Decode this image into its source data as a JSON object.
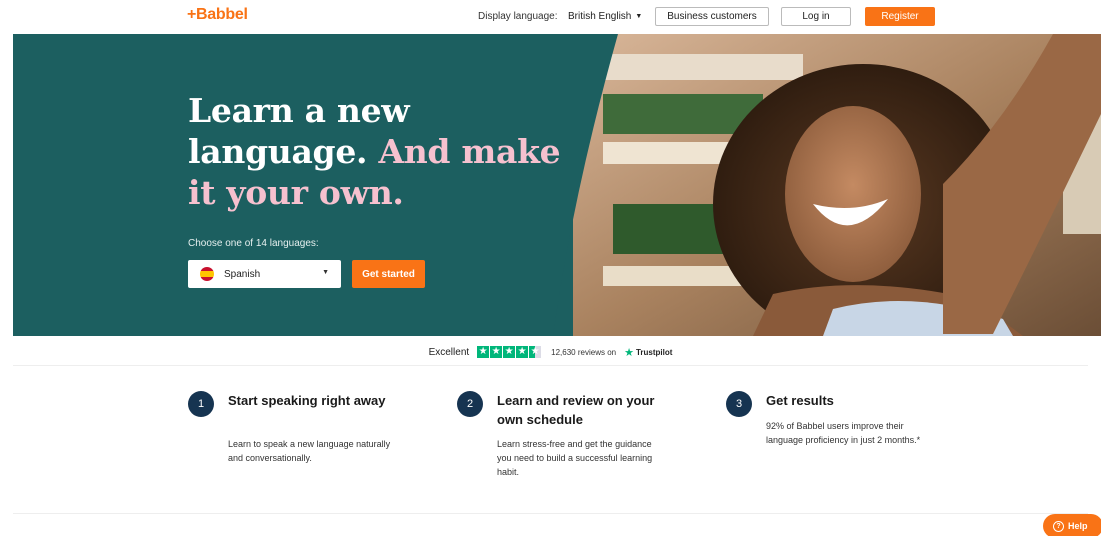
{
  "header": {
    "logo": "+Babbel",
    "display_language_label": "Display language:",
    "display_language_value": "British English",
    "business_button": "Business customers",
    "login_button": "Log in",
    "register_button": "Register"
  },
  "hero": {
    "title_white": "Learn a new language.",
    "title_pink": "And make it your own.",
    "choose_label": "Choose one of 14 languages:",
    "selected_language": "Spanish",
    "cta": "Get started"
  },
  "trustpilot": {
    "rating_word": "Excellent",
    "stars": 4.5,
    "reviews": "12,630 reviews on",
    "brand": "Trustpilot"
  },
  "features": [
    {
      "number": "1",
      "title": "Start speaking right away",
      "text": "Learn to speak a new language naturally and conversationally."
    },
    {
      "number": "2",
      "title": "Learn and review on your own schedule",
      "text": "Learn stress-free and get the guidance you need to build a successful learning habit."
    },
    {
      "number": "3",
      "title": "Get results",
      "text": "92% of Babbel users improve their language proficiency in just 2 months.*"
    }
  ],
  "help_button": "Help",
  "colors": {
    "accent": "#f97316",
    "hero_teal": "#1c5f60",
    "hero_pink": "#f6c1cf",
    "navy": "#163451",
    "trustpilot_green": "#00b67a"
  }
}
